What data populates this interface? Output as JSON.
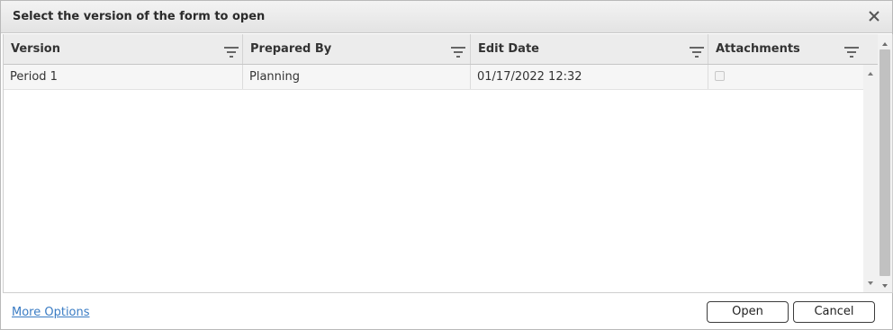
{
  "dialog": {
    "title": "Select the version of the form to open",
    "close_icon": "close-icon"
  },
  "grid": {
    "columns": [
      {
        "label": "Version",
        "filter_icon": "filter-icon"
      },
      {
        "label": "Prepared By",
        "filter_icon": "filter-icon"
      },
      {
        "label": "Edit Date",
        "filter_icon": "filter-icon"
      },
      {
        "label": "Attachments",
        "filter_icon": "filter-icon"
      }
    ],
    "rows": [
      {
        "version": "Period 1",
        "prepared_by": "Planning",
        "edit_date": "01/17/2022 12:32",
        "attachments": false
      }
    ]
  },
  "footer": {
    "more_options": "More Options",
    "open_label": "Open",
    "cancel_label": "Cancel"
  },
  "colors": {
    "link": "#3a7cc4",
    "header_bg": "#ececec",
    "titlebar_bg": "#e8e8e8",
    "row_bg": "#f6f6f6"
  }
}
